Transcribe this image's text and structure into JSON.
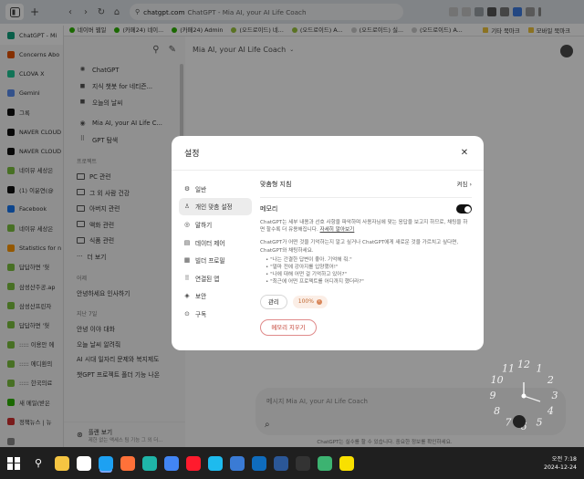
{
  "browser": {
    "url_domain": "chatgpt.com",
    "page_title": "ChatGPT - Mia AI, your AI Life Coach",
    "active_tab_label": "ChatGPT - Mi",
    "bookmarks": [
      {
        "label": "네이버 웹일",
        "color": "#2db400"
      },
      {
        "label": "(카페24) 네이...",
        "color": "#2db400"
      },
      {
        "label": "(카페24) Admin",
        "color": "#2db400"
      },
      {
        "label": "(오드로이드) 네...",
        "color": "#9bc53d"
      },
      {
        "label": "(오드로이드) A...",
        "color": "#9bc53d"
      },
      {
        "label": "(오드로이드) 실...",
        "color": "#cccccc"
      },
      {
        "label": "(오드로이드) A...",
        "color": "#cccccc"
      }
    ],
    "bookmarks_right": [
      {
        "label": "기타 북마크",
        "color": "#f0c43c"
      },
      {
        "label": "모바일 북마크",
        "color": "#f0c43c"
      }
    ]
  },
  "vertical_tabs": [
    {
      "label": "ChatGPT - Mi",
      "color": "#10a37f",
      "active": true
    },
    {
      "label": "Concerns Abo",
      "color": "#e65100"
    },
    {
      "label": "CLOVA X",
      "color": "#20c997"
    },
    {
      "label": "Gemini",
      "color": "#5b8def"
    },
    {
      "label": "그록",
      "color": "#111111"
    },
    {
      "label": "NAVER CLOUD",
      "color": "#111111"
    },
    {
      "label": "NAVER CLOUD",
      "color": "#111111"
    },
    {
      "label": "네이뮤 세상은",
      "color": "#7cc13f"
    },
    {
      "label": "(1) 이윤연(@",
      "color": "#111111"
    },
    {
      "label": "Facebook",
      "color": "#1877f2"
    },
    {
      "label": "네이뮤 세상은",
      "color": "#7cc13f"
    },
    {
      "label": "Statistics for n",
      "color": "#ff9800"
    },
    {
      "label": "답답하면 '헛",
      "color": "#7cc13f"
    },
    {
      "label": "삼성산주공.ap",
      "color": "#7cc13f"
    },
    {
      "label": "삼성산프린자",
      "color": "#7cc13f"
    },
    {
      "label": "답답하면 '헛",
      "color": "#7cc13f"
    },
    {
      "label": "::::: 이용안 에",
      "color": "#7cc13f"
    },
    {
      "label": "::::: 에디환의",
      "color": "#7cc13f"
    },
    {
      "label": "::::: 한국의료",
      "color": "#7cc13f"
    },
    {
      "label": "새 메일(받은",
      "color": "#2db400"
    },
    {
      "label": "정책뉴스 | 뉴",
      "color": "#d32f2f"
    },
    {
      "label": "",
      "color": "#888888"
    }
  ],
  "chatgpt_sidebar": {
    "items": [
      {
        "icon": "openai-icon",
        "glyph": "✺",
        "label": "ChatGPT"
      },
      {
        "icon": "gpt-icon",
        "glyph": "◼",
        "label": "지식 챗봇 for 네티즌..."
      },
      {
        "icon": "gpt-icon",
        "glyph": "◼",
        "label": "오늘의 날씨"
      },
      {
        "icon": "gpt-icon",
        "glyph": "◉",
        "label": "Mia AI, your AI Life C..."
      },
      {
        "icon": "grid-icon",
        "glyph": "⠿",
        "label": "GPT 탐색"
      }
    ],
    "projects_heading": "프로젝트",
    "projects": [
      "PC 관련",
      "그 외 사람 건강",
      "아버지 관련",
      "액화 관련",
      "식품 관련"
    ],
    "more_label": "더 보기",
    "yesterday_heading": "어제",
    "yesterday": [
      "안녕하세요 인사하기"
    ],
    "week_heading": "지난 7일",
    "week": [
      "안녕 이야 대화",
      "오늘 날씨 알려줘",
      "AI 시대 일자리 문제와 복지제도",
      "챗GPT 프로젝트 폴더 기능 나온"
    ],
    "upgrade_label": "플랜 보기",
    "upgrade_sub": "제한 없는 액세스 팀 기능 그 외 더..."
  },
  "chatgpt_main": {
    "header_title": "Mia AI, your AI Life Coach",
    "composer_placeholder": "메시지 Mia AI, your AI Life Coach",
    "disclaimer": "ChatGPT는 실수를 할 수 있습니다. 중요한 정보를 확인하세요."
  },
  "settings_modal": {
    "title": "설정",
    "nav": [
      {
        "icon": "gear-icon",
        "glyph": "⚙",
        "label": "일반",
        "selected": false
      },
      {
        "icon": "personalization-icon",
        "glyph": "♙",
        "label": "개인 맞춤 설정",
        "selected": true
      },
      {
        "icon": "speech-icon",
        "glyph": "◎",
        "label": "말하기",
        "selected": false
      },
      {
        "icon": "data-icon",
        "glyph": "▤",
        "label": "데이터 제어",
        "selected": false
      },
      {
        "icon": "builder-icon",
        "glyph": "▦",
        "label": "빌더 프로필",
        "selected": false
      },
      {
        "icon": "apps-icon",
        "glyph": "⠿",
        "label": "연결된 앱",
        "selected": false
      },
      {
        "icon": "shield-icon",
        "glyph": "◈",
        "label": "보안",
        "selected": false
      },
      {
        "icon": "subscription-icon",
        "glyph": "⊙",
        "label": "구독",
        "selected": false
      }
    ],
    "custom_instructions_label": "맞춤형 지침",
    "custom_instructions_state": "켜짐",
    "memory_label": "메모리",
    "memory_enabled": true,
    "memory_desc": "ChatGPT는 세부 내용과 선호 사항을 파악하며 사용자님에 맞는 응답을 보고지 하므로, 채팅을 하면 할수록 더 유용해집니다.",
    "memory_link": "자세히 알아보기",
    "memory_desc2": "ChatGPT가 어떤 것을 기억하는지 알고 싶거나 ChatGPT에게 새로운 것을 가르치고 싶다면, ChatGPT와 채팅하세요.",
    "examples": [
      "\"나는 간결한 답변이 좋아. 기억해 줘.\"",
      "\"얼마 전에 강아지를 입양했어!\"",
      "\"나에 대해 어떤 걸 기억하고 있어?\"",
      "\"최근에 어떤 프로젝트를 어디까지 했더라?\""
    ],
    "manage_label": "관리",
    "usage_pct": "100%",
    "clear_label": "메모리 지우기"
  },
  "clock_numbers": [
    "12",
    "1",
    "2",
    "3",
    "4",
    "5",
    "6",
    "7",
    "8",
    "9",
    "10",
    "11"
  ],
  "taskbar": {
    "apps": [
      {
        "icon": "file-explorer-icon",
        "color": "#f5c542"
      },
      {
        "icon": "chatgpt-app-icon",
        "color": "#ffffff"
      },
      {
        "icon": "twitter-icon",
        "color": "#1da1f2"
      },
      {
        "icon": "firefox-icon",
        "color": "#ff7139"
      },
      {
        "icon": "edge-icon",
        "color": "#1fb5a8"
      },
      {
        "icon": "chrome-icon",
        "color": "#4285f4"
      },
      {
        "icon": "opera-icon",
        "color": "#ff1b2d"
      },
      {
        "icon": "ie-icon",
        "color": "#1ebbee"
      },
      {
        "icon": "store-icon",
        "color": "#3a7bd5"
      },
      {
        "icon": "outlook-icon",
        "color": "#0f6cbd"
      },
      {
        "icon": "app-blue-icon",
        "color": "#2b5797"
      },
      {
        "icon": "terminal-icon",
        "color": "#333333"
      },
      {
        "icon": "folder-green-icon",
        "color": "#3cb371"
      },
      {
        "icon": "kakaotalk-icon",
        "color": "#f9e000"
      }
    ],
    "time": "오전 7:18",
    "date": "2024-12-24"
  }
}
